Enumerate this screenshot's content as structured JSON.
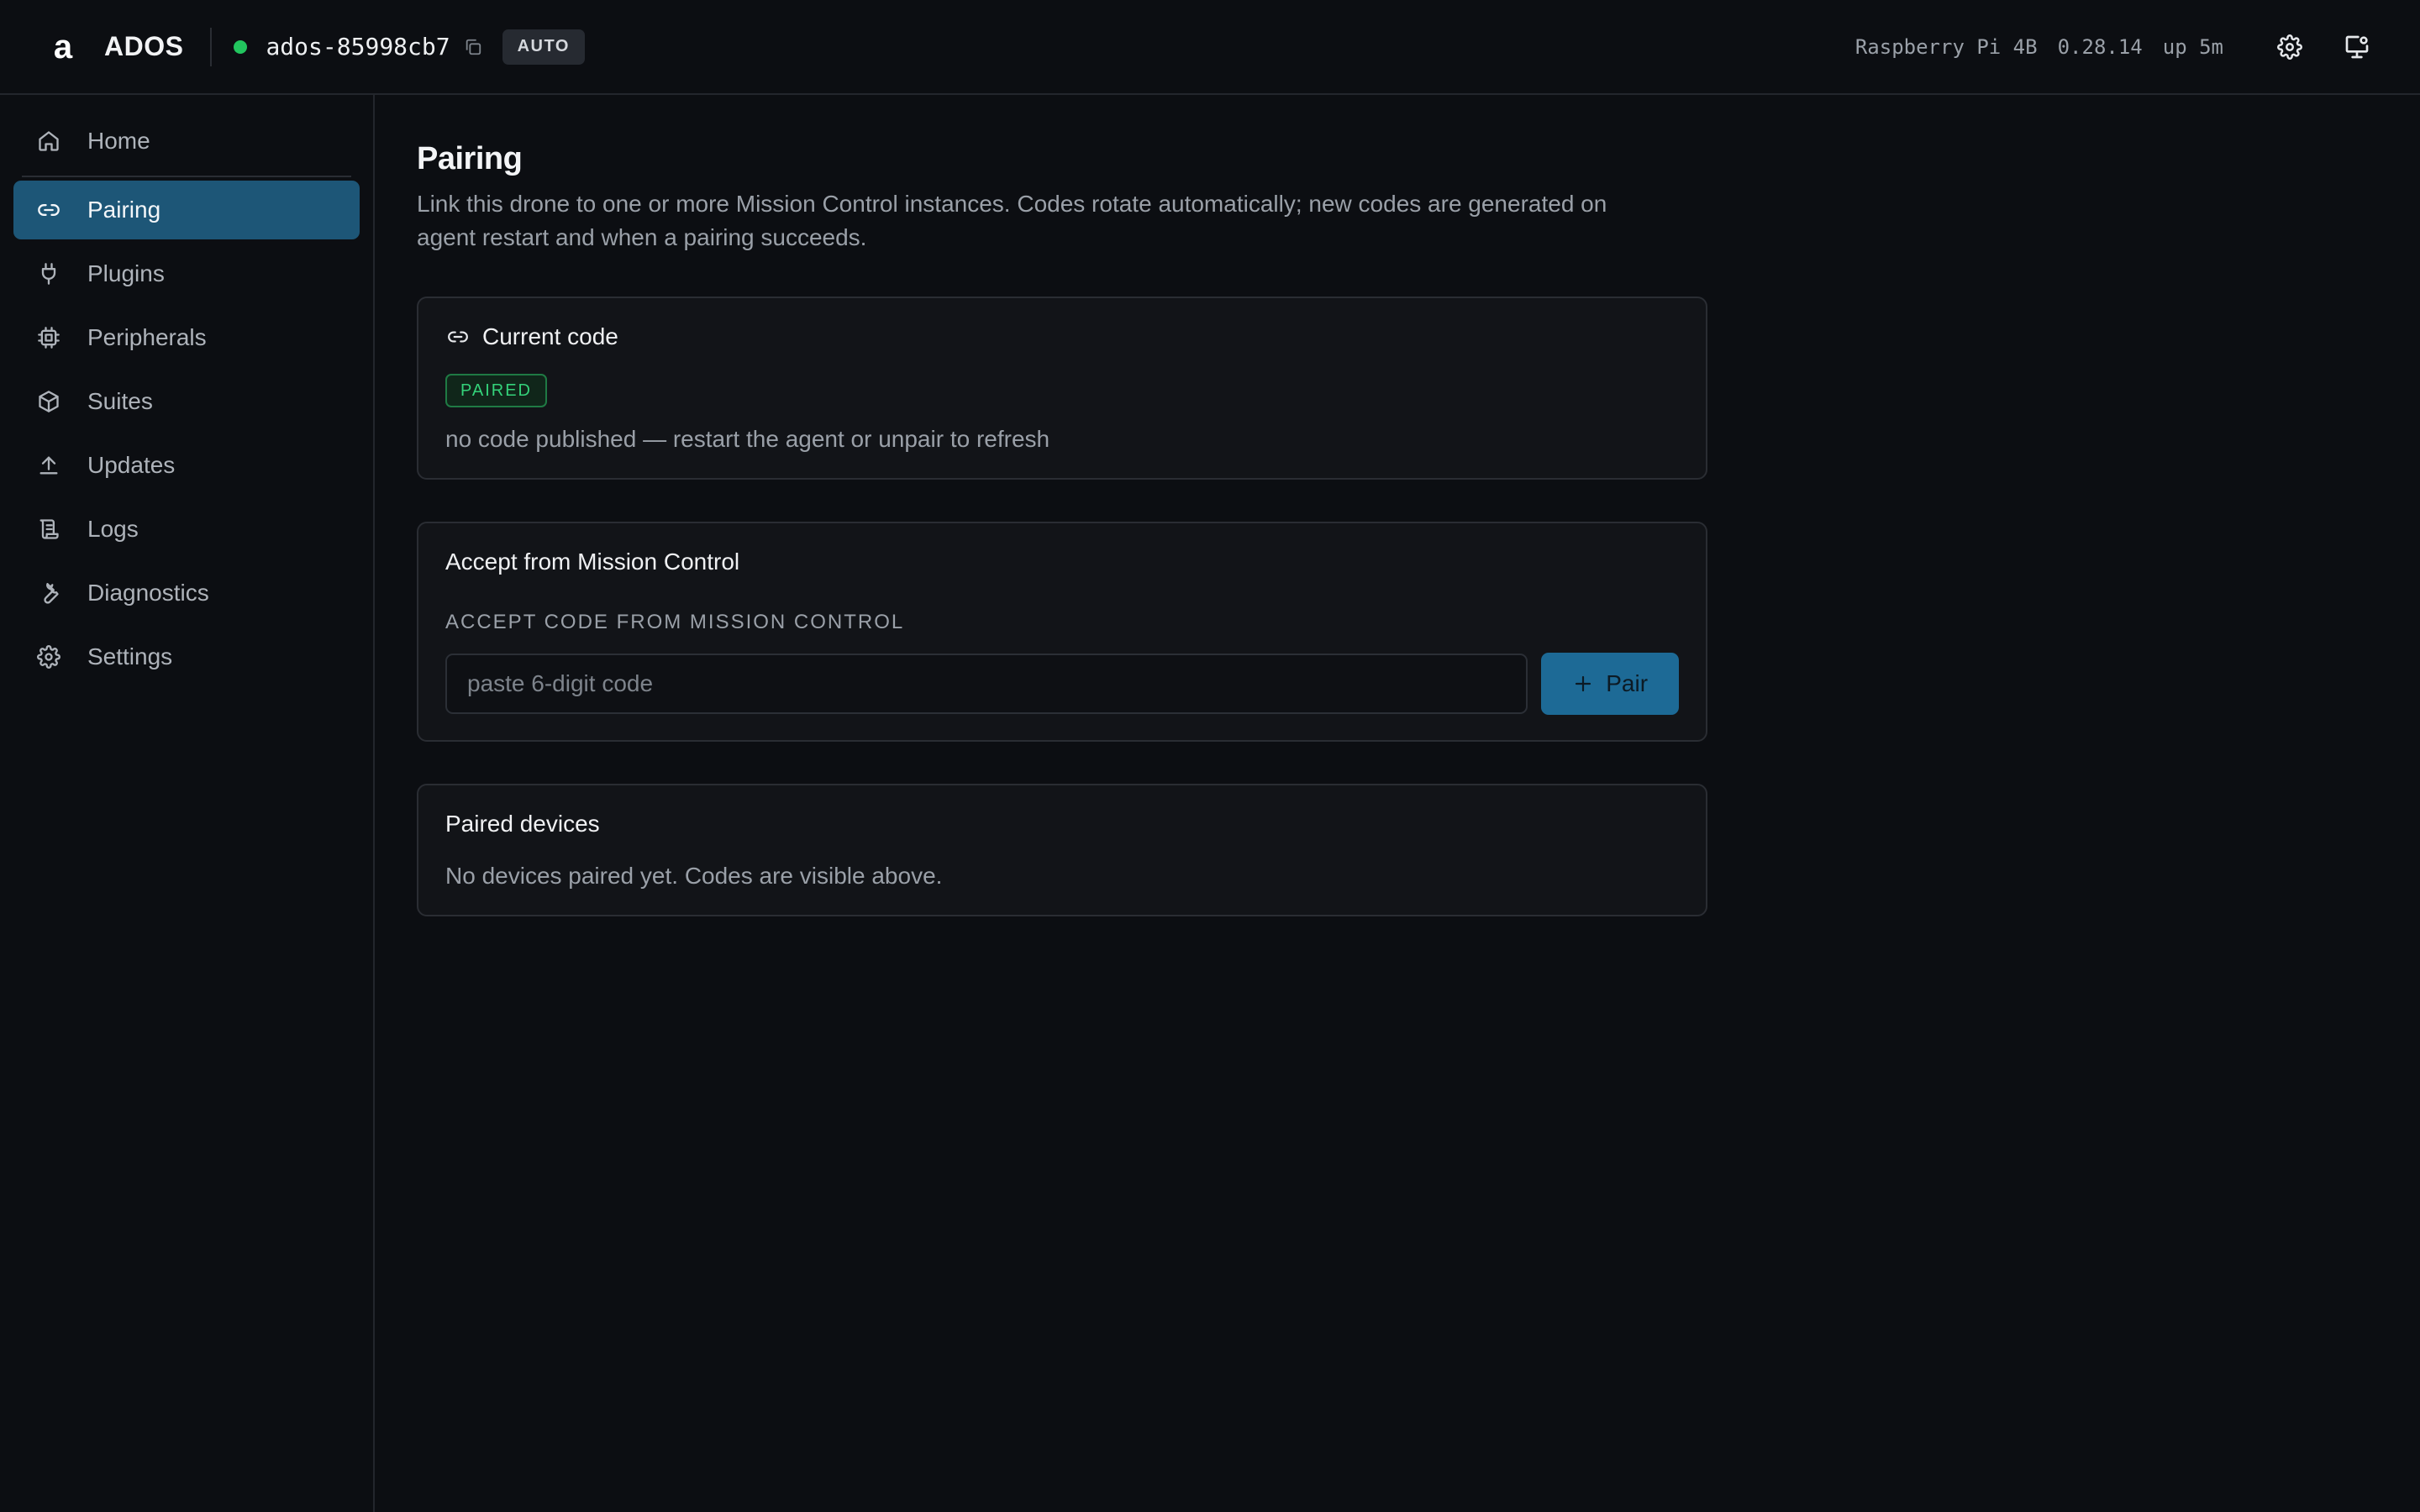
{
  "header": {
    "brand": "ADOS",
    "device_id": "ados-85998cb7",
    "mode_badge": "AUTO",
    "board": "Raspberry Pi 4B",
    "version": "0.28.14",
    "uptime": "up 5m",
    "status_color": "#22c55e"
  },
  "sidebar": {
    "items": [
      {
        "label": "Home",
        "icon": "home-icon"
      },
      {
        "label": "Pairing",
        "icon": "link-icon",
        "active": true
      },
      {
        "label": "Plugins",
        "icon": "plug-icon"
      },
      {
        "label": "Peripherals",
        "icon": "chip-icon"
      },
      {
        "label": "Suites",
        "icon": "package-icon"
      },
      {
        "label": "Updates",
        "icon": "upload-icon"
      },
      {
        "label": "Logs",
        "icon": "scroll-icon"
      },
      {
        "label": "Diagnostics",
        "icon": "wrench-icon"
      },
      {
        "label": "Settings",
        "icon": "gear-icon"
      }
    ]
  },
  "main": {
    "title": "Pairing",
    "description": "Link this drone to one or more Mission Control instances. Codes rotate automatically; new codes are generated on agent restart and when a pairing succeeds.",
    "current_code": {
      "title": "Current code",
      "status": "PAIRED",
      "message": "no code published — restart the agent or unpair to refresh"
    },
    "accept": {
      "title": "Accept from Mission Control",
      "label": "ACCEPT CODE FROM MISSION CONTROL",
      "placeholder": "paste 6-digit code",
      "value": "",
      "button": "Pair"
    },
    "paired_devices": {
      "title": "Paired devices",
      "empty_message": "No devices paired yet. Codes are visible above."
    }
  },
  "colors": {
    "accent": "#1d5677",
    "button": "#1d6a96",
    "success": "#22c55e",
    "background": "#0c0e12"
  }
}
